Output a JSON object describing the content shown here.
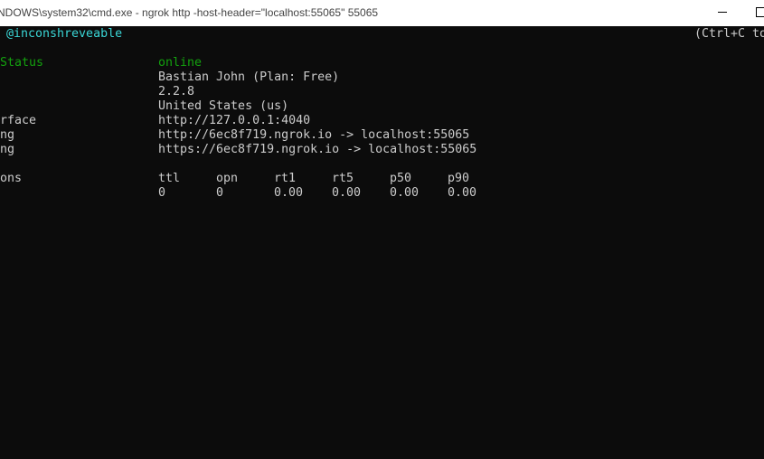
{
  "window": {
    "title": "NDOWS\\system32\\cmd.exe - ngrok  http -host-header=\"localhost:55065\" 55065"
  },
  "console": {
    "header_left": "@inconshreveable",
    "header_right": "(Ctrl+C to",
    "rows": {
      "status_label": "Status",
      "status_value": "online",
      "account_value": "Bastian John (Plan: Free)",
      "version_value": "2.2.8",
      "region_value": "United States (us)",
      "interface_label": "rface",
      "interface_value": "http://127.0.0.1:4040",
      "forward1_label": "ng",
      "forward1_value": "http://6ec8f719.ngrok.io -> localhost:55065",
      "forward2_label": "ng",
      "forward2_value": "https://6ec8f719.ngrok.io -> localhost:55065",
      "connections_label": "ons"
    },
    "connections": {
      "headers": [
        "ttl",
        "opn",
        "rt1",
        "rt5",
        "p50",
        "p90"
      ],
      "values": [
        "0",
        "0",
        "0.00",
        "0.00",
        "0.00",
        "0.00"
      ]
    }
  },
  "colors": {
    "background": "#0c0c0c",
    "text": "#cccccc",
    "accent_cyan": "#3ad6d6",
    "status_green": "#13a10e"
  }
}
